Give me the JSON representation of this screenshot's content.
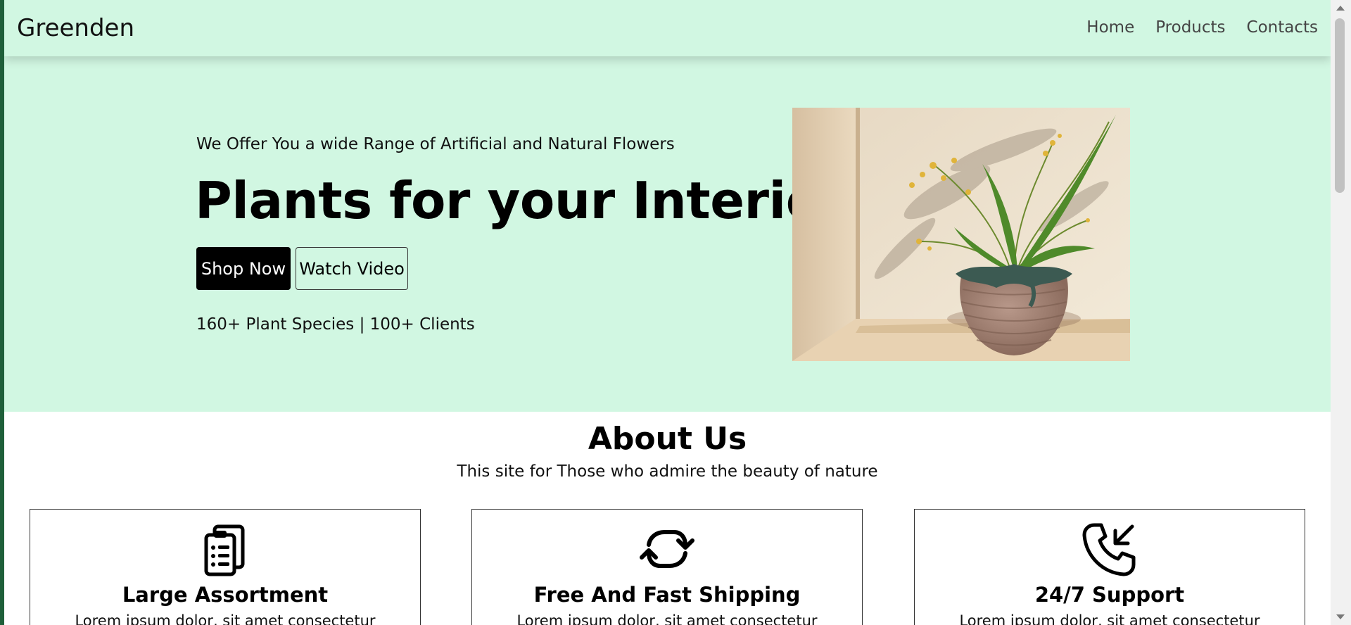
{
  "navbar": {
    "brand": "Greenden",
    "links": [
      "Home",
      "Products",
      "Contacts"
    ]
  },
  "hero": {
    "subtitle": "We Offer You a wide Range of Artificial and Natural Flowers",
    "title": "Plants for your Interior",
    "shop_button": "Shop Now",
    "video_button": "Watch Video",
    "stats": "160+ Plant Species | 100+ Clients",
    "image_icon": "potted-plant-photo"
  },
  "about": {
    "title": "About Us",
    "subtitle": "This site for Those who admire the beauty of nature",
    "cards": [
      {
        "icon": "clipboard-icon",
        "title": "Large Assortment",
        "text": "Lorem ipsum dolor, sit amet consectetur"
      },
      {
        "icon": "refresh-icon",
        "title": "Free And Fast Shipping",
        "text": "Lorem ipsum dolor, sit amet consectetur"
      },
      {
        "icon": "phone-incoming-icon",
        "title": "24/7 Support",
        "text": "Lorem ipsum dolor, sit amet consectetur"
      }
    ]
  },
  "colors": {
    "hero_bg": "#d1f7e2",
    "window_frame": "#1f5f3a",
    "primary_button": "#000000"
  }
}
